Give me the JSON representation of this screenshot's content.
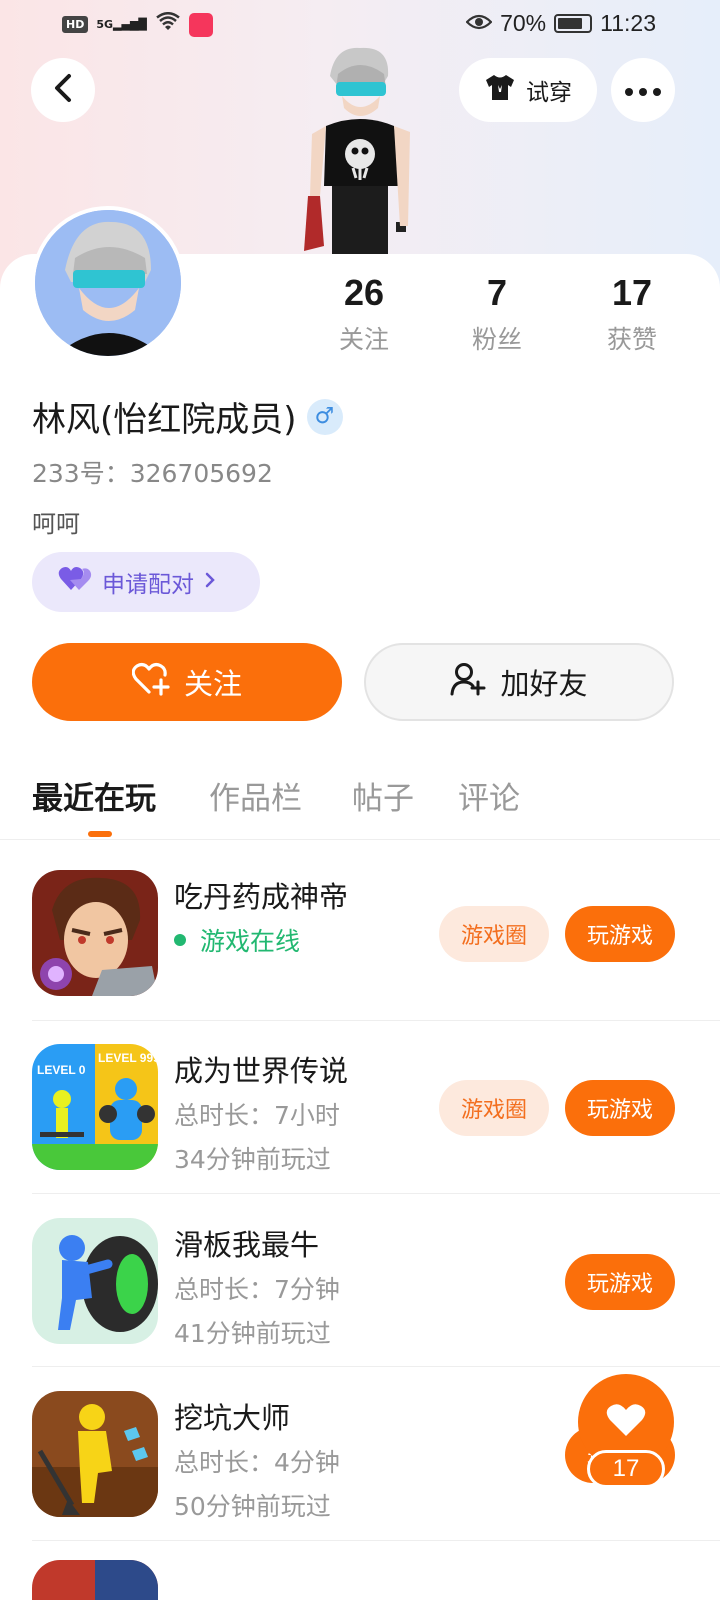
{
  "status_bar": {
    "network": "HD",
    "signal": "5G",
    "battery": "70%",
    "time": "11:23"
  },
  "header": {
    "tryon_label": "试穿"
  },
  "profile": {
    "stats": [
      {
        "num": "26",
        "label": "关注"
      },
      {
        "num": "7",
        "label": "粉丝"
      },
      {
        "num": "17",
        "label": "获赞"
      }
    ],
    "username": "林风(怡红院成员)",
    "gender_symbol": "♂",
    "uid": "233号：326705692",
    "bio": "呵呵",
    "pair_label": "申请配对"
  },
  "actions": {
    "follow_label": "关注",
    "add_friend_label": "加好友"
  },
  "tabs": [
    "最近在玩",
    "作品栏",
    "帖子",
    "评论"
  ],
  "games": [
    {
      "name": "吃丹药成神帝",
      "status": "游戏在线",
      "circle": "游戏圈",
      "play": "玩游戏"
    },
    {
      "name": "成为世界传说",
      "duration": "总时长：7小时",
      "last": "34分钟前玩过",
      "circle": "游戏圈",
      "play": "玩游戏"
    },
    {
      "name": "滑板我最牛",
      "duration": "总时长：7分钟",
      "last": "41分钟前玩过",
      "play": "玩游戏"
    },
    {
      "name": "挖坑大师",
      "duration": "总时长：4分钟",
      "last": "50分钟前玩过",
      "play": "玩游戏"
    }
  ],
  "like_fab": {
    "count": "17"
  },
  "colors": {
    "accent": "#fb6f0b",
    "online": "#22b871",
    "pair": "#6b58d8"
  }
}
